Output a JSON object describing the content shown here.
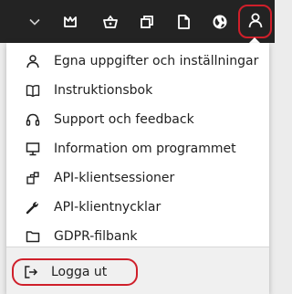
{
  "topbar": {
    "icons": [
      "chevron-down-icon",
      "crown-icon",
      "basket-icon",
      "copy-icon",
      "document-icon",
      "globe-icon",
      "user-icon"
    ]
  },
  "menu": {
    "items": [
      {
        "label": "Egna uppgifter och inställningar",
        "icon": "user-icon"
      },
      {
        "label": "Instruktionsbok",
        "icon": "book-icon"
      },
      {
        "label": "Support och feedback",
        "icon": "headset-icon"
      },
      {
        "label": "Information om programmet",
        "icon": "monitor-icon"
      },
      {
        "label": "API-klientsessioner",
        "icon": "api-sessions-icon"
      },
      {
        "label": "API-klientnycklar",
        "icon": "wrench-icon"
      },
      {
        "label": "GDPR-filbank",
        "icon": "folder-icon"
      }
    ],
    "logout": {
      "label": "Logga ut",
      "icon": "logout-icon"
    }
  },
  "colors": {
    "topbar": "#232323",
    "highlight": "#cf1f2a",
    "menu_bg": "#ffffff",
    "footer_bg": "#f0f0f0"
  }
}
